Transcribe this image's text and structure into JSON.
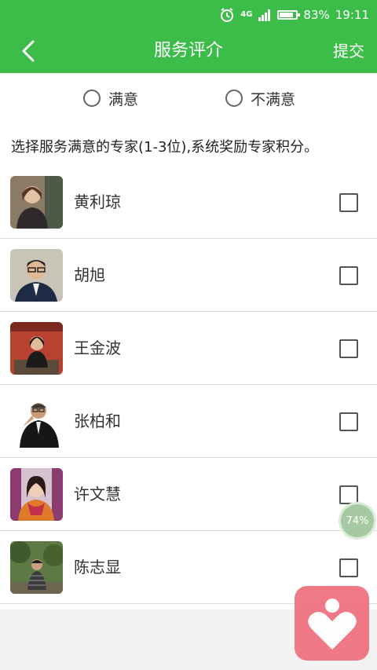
{
  "status_bar": {
    "network": "4G",
    "battery_percent_text": "83%",
    "battery_level": 0.83,
    "time": "19:11"
  },
  "app_bar": {
    "title": "服务评介",
    "submit_label": "提交"
  },
  "rating": {
    "options": [
      {
        "label": "满意",
        "selected": false
      },
      {
        "label": "不满意",
        "selected": false
      }
    ]
  },
  "instruction": "选择服务满意的专家(1-3位),系统奖励专家积分。",
  "experts": [
    {
      "name": "黄利琼",
      "checked": false
    },
    {
      "name": "胡旭",
      "checked": false
    },
    {
      "name": "王金波",
      "checked": false
    },
    {
      "name": "张柏和",
      "checked": false
    },
    {
      "name": "许文慧",
      "checked": false
    },
    {
      "name": "陈志显",
      "checked": false
    }
  ],
  "progress_badge": "74%",
  "colors": {
    "accent": "#3cbd4a",
    "fab": "#ef6b7b"
  },
  "icons": {
    "back": "chevron-left-icon",
    "alarm": "alarm-icon",
    "signal": "signal-icon",
    "battery": "battery-icon",
    "radio": "radio-circle-icon",
    "checkbox": "checkbox-icon",
    "fab": "heart-person-icon"
  }
}
